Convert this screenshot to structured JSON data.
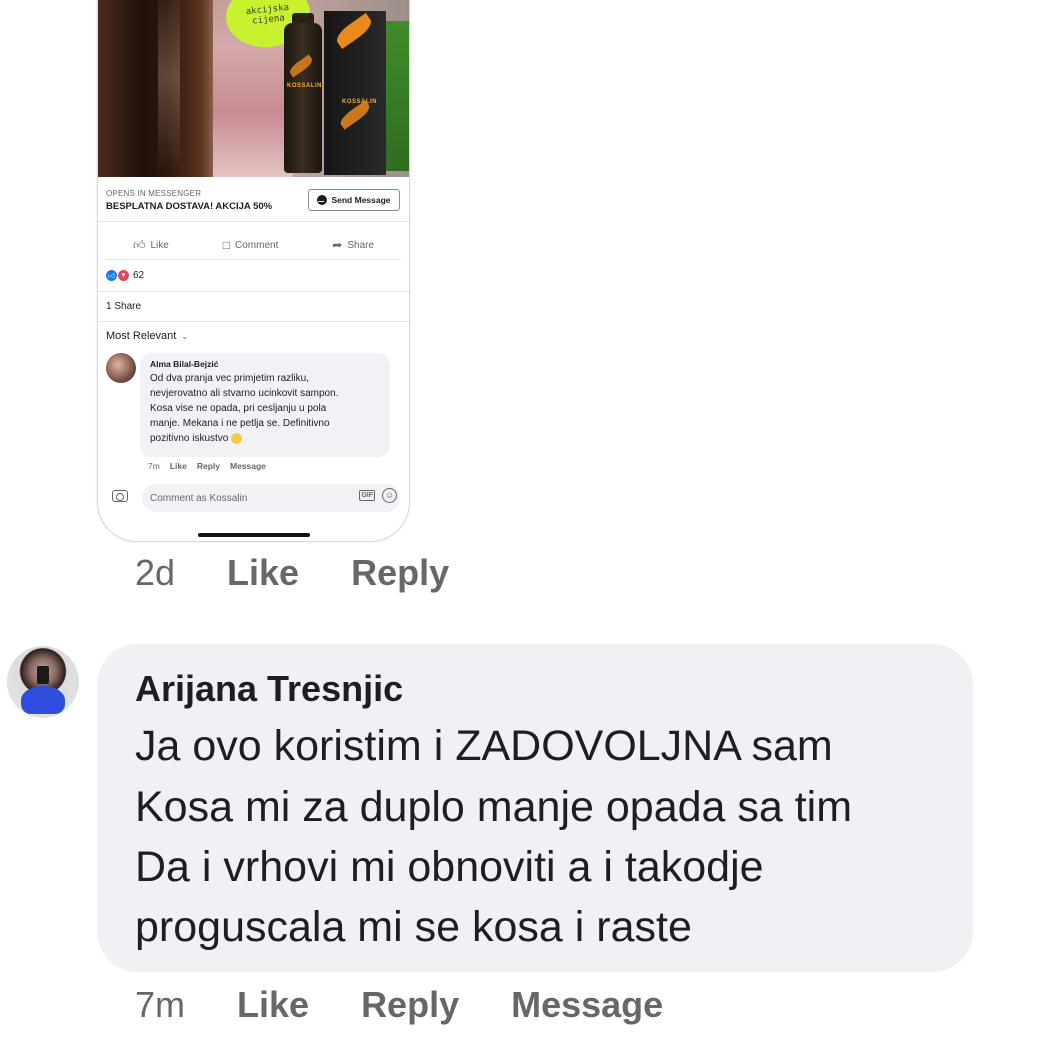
{
  "ad_post": {
    "promo_badge": "akcijska cijena",
    "promo_badge_lines": [
      "akcijska",
      "cijena"
    ],
    "brand": "KOSSALIN",
    "cta_small": "OPENS IN MESSENGER",
    "cta_title": "BESPLATNA DOSTAVA! AKCIJA 50%",
    "send_button": "Send Message",
    "actions": {
      "like": "Like",
      "comment": "Comment",
      "share": "Share"
    },
    "reaction_count": "62",
    "shares": "1 Share",
    "sort_label": "Most Relevant",
    "inner_comment": {
      "author": "Alma Bilal-Bejzić",
      "text": "Od dva pranja vec primjetim razliku,\nnevjerovatno ali stvarno ucinkovit sampon.\nKosa vise ne opada, pri cesljanju u pola\nmanje. Mekana i ne petlja se. Definitivno\npozitivno iskustvo",
      "time": "7m",
      "like": "Like",
      "reply": "Reply",
      "message": "Message"
    },
    "compose_placeholder": "Comment as Kossalin",
    "gif_label": "GIF"
  },
  "post_meta": {
    "time": "2d",
    "like": "Like",
    "reply": "Reply"
  },
  "comment": {
    "author": "Arijana Tresnjic",
    "lines": [
      "Ja ovo koristim i ZADOVOLJNA sam",
      "Kosa mi za duplo manje opada sa tim",
      "Da i vrhovi mi obnoviti a i takodje",
      "proguscala mi se kosa i raste"
    ],
    "time": "7m",
    "like": "Like",
    "reply": "Reply",
    "message": "Message"
  },
  "colors": {
    "bubble": "#f0f1f4",
    "meta_text": "#65676b",
    "like_blue": "#1877f2",
    "love_red": "#f33e58"
  }
}
